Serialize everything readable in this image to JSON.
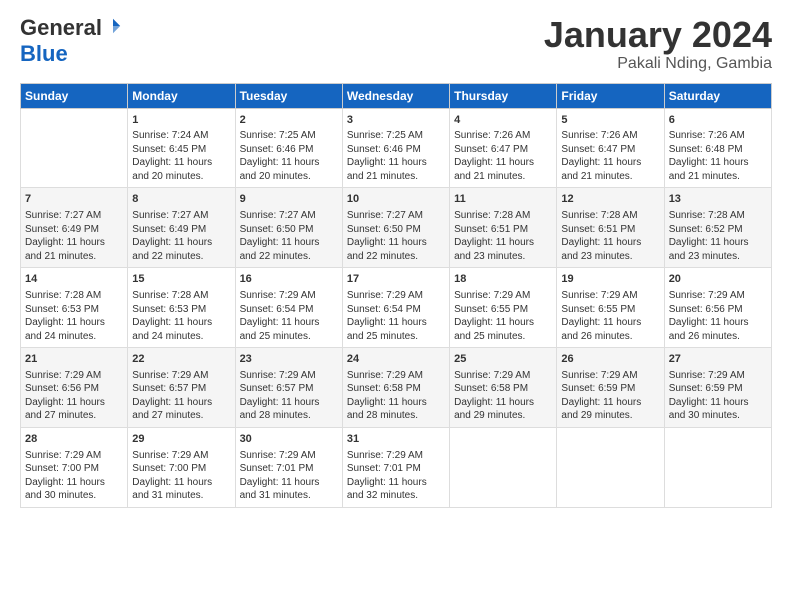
{
  "header": {
    "logo_line1": "General",
    "logo_line2": "Blue",
    "main_title": "January 2024",
    "subtitle": "Pakali Nding, Gambia"
  },
  "days": [
    "Sunday",
    "Monday",
    "Tuesday",
    "Wednesday",
    "Thursday",
    "Friday",
    "Saturday"
  ],
  "weeks": [
    [
      {
        "date": "",
        "sunrise": "",
        "sunset": "",
        "daylight": ""
      },
      {
        "date": "1",
        "sunrise": "7:24 AM",
        "sunset": "6:45 PM",
        "daylight": "11 hours and 20 minutes."
      },
      {
        "date": "2",
        "sunrise": "7:25 AM",
        "sunset": "6:46 PM",
        "daylight": "11 hours and 20 minutes."
      },
      {
        "date": "3",
        "sunrise": "7:25 AM",
        "sunset": "6:46 PM",
        "daylight": "11 hours and 21 minutes."
      },
      {
        "date": "4",
        "sunrise": "7:26 AM",
        "sunset": "6:47 PM",
        "daylight": "11 hours and 21 minutes."
      },
      {
        "date": "5",
        "sunrise": "7:26 AM",
        "sunset": "6:47 PM",
        "daylight": "11 hours and 21 minutes."
      },
      {
        "date": "6",
        "sunrise": "7:26 AM",
        "sunset": "6:48 PM",
        "daylight": "11 hours and 21 minutes."
      }
    ],
    [
      {
        "date": "7",
        "sunrise": "7:27 AM",
        "sunset": "6:49 PM",
        "daylight": "11 hours and 21 minutes."
      },
      {
        "date": "8",
        "sunrise": "7:27 AM",
        "sunset": "6:49 PM",
        "daylight": "11 hours and 22 minutes."
      },
      {
        "date": "9",
        "sunrise": "7:27 AM",
        "sunset": "6:50 PM",
        "daylight": "11 hours and 22 minutes."
      },
      {
        "date": "10",
        "sunrise": "7:27 AM",
        "sunset": "6:50 PM",
        "daylight": "11 hours and 22 minutes."
      },
      {
        "date": "11",
        "sunrise": "7:28 AM",
        "sunset": "6:51 PM",
        "daylight": "11 hours and 23 minutes."
      },
      {
        "date": "12",
        "sunrise": "7:28 AM",
        "sunset": "6:51 PM",
        "daylight": "11 hours and 23 minutes."
      },
      {
        "date": "13",
        "sunrise": "7:28 AM",
        "sunset": "6:52 PM",
        "daylight": "11 hours and 23 minutes."
      }
    ],
    [
      {
        "date": "14",
        "sunrise": "7:28 AM",
        "sunset": "6:53 PM",
        "daylight": "11 hours and 24 minutes."
      },
      {
        "date": "15",
        "sunrise": "7:28 AM",
        "sunset": "6:53 PM",
        "daylight": "11 hours and 24 minutes."
      },
      {
        "date": "16",
        "sunrise": "7:29 AM",
        "sunset": "6:54 PM",
        "daylight": "11 hours and 25 minutes."
      },
      {
        "date": "17",
        "sunrise": "7:29 AM",
        "sunset": "6:54 PM",
        "daylight": "11 hours and 25 minutes."
      },
      {
        "date": "18",
        "sunrise": "7:29 AM",
        "sunset": "6:55 PM",
        "daylight": "11 hours and 25 minutes."
      },
      {
        "date": "19",
        "sunrise": "7:29 AM",
        "sunset": "6:55 PM",
        "daylight": "11 hours and 26 minutes."
      },
      {
        "date": "20",
        "sunrise": "7:29 AM",
        "sunset": "6:56 PM",
        "daylight": "11 hours and 26 minutes."
      }
    ],
    [
      {
        "date": "21",
        "sunrise": "7:29 AM",
        "sunset": "6:56 PM",
        "daylight": "11 hours and 27 minutes."
      },
      {
        "date": "22",
        "sunrise": "7:29 AM",
        "sunset": "6:57 PM",
        "daylight": "11 hours and 27 minutes."
      },
      {
        "date": "23",
        "sunrise": "7:29 AM",
        "sunset": "6:57 PM",
        "daylight": "11 hours and 28 minutes."
      },
      {
        "date": "24",
        "sunrise": "7:29 AM",
        "sunset": "6:58 PM",
        "daylight": "11 hours and 28 minutes."
      },
      {
        "date": "25",
        "sunrise": "7:29 AM",
        "sunset": "6:58 PM",
        "daylight": "11 hours and 29 minutes."
      },
      {
        "date": "26",
        "sunrise": "7:29 AM",
        "sunset": "6:59 PM",
        "daylight": "11 hours and 29 minutes."
      },
      {
        "date": "27",
        "sunrise": "7:29 AM",
        "sunset": "6:59 PM",
        "daylight": "11 hours and 30 minutes."
      }
    ],
    [
      {
        "date": "28",
        "sunrise": "7:29 AM",
        "sunset": "7:00 PM",
        "daylight": "11 hours and 30 minutes."
      },
      {
        "date": "29",
        "sunrise": "7:29 AM",
        "sunset": "7:00 PM",
        "daylight": "11 hours and 31 minutes."
      },
      {
        "date": "30",
        "sunrise": "7:29 AM",
        "sunset": "7:01 PM",
        "daylight": "11 hours and 31 minutes."
      },
      {
        "date": "31",
        "sunrise": "7:29 AM",
        "sunset": "7:01 PM",
        "daylight": "11 hours and 32 minutes."
      },
      {
        "date": "",
        "sunrise": "",
        "sunset": "",
        "daylight": ""
      },
      {
        "date": "",
        "sunrise": "",
        "sunset": "",
        "daylight": ""
      },
      {
        "date": "",
        "sunrise": "",
        "sunset": "",
        "daylight": ""
      }
    ]
  ]
}
